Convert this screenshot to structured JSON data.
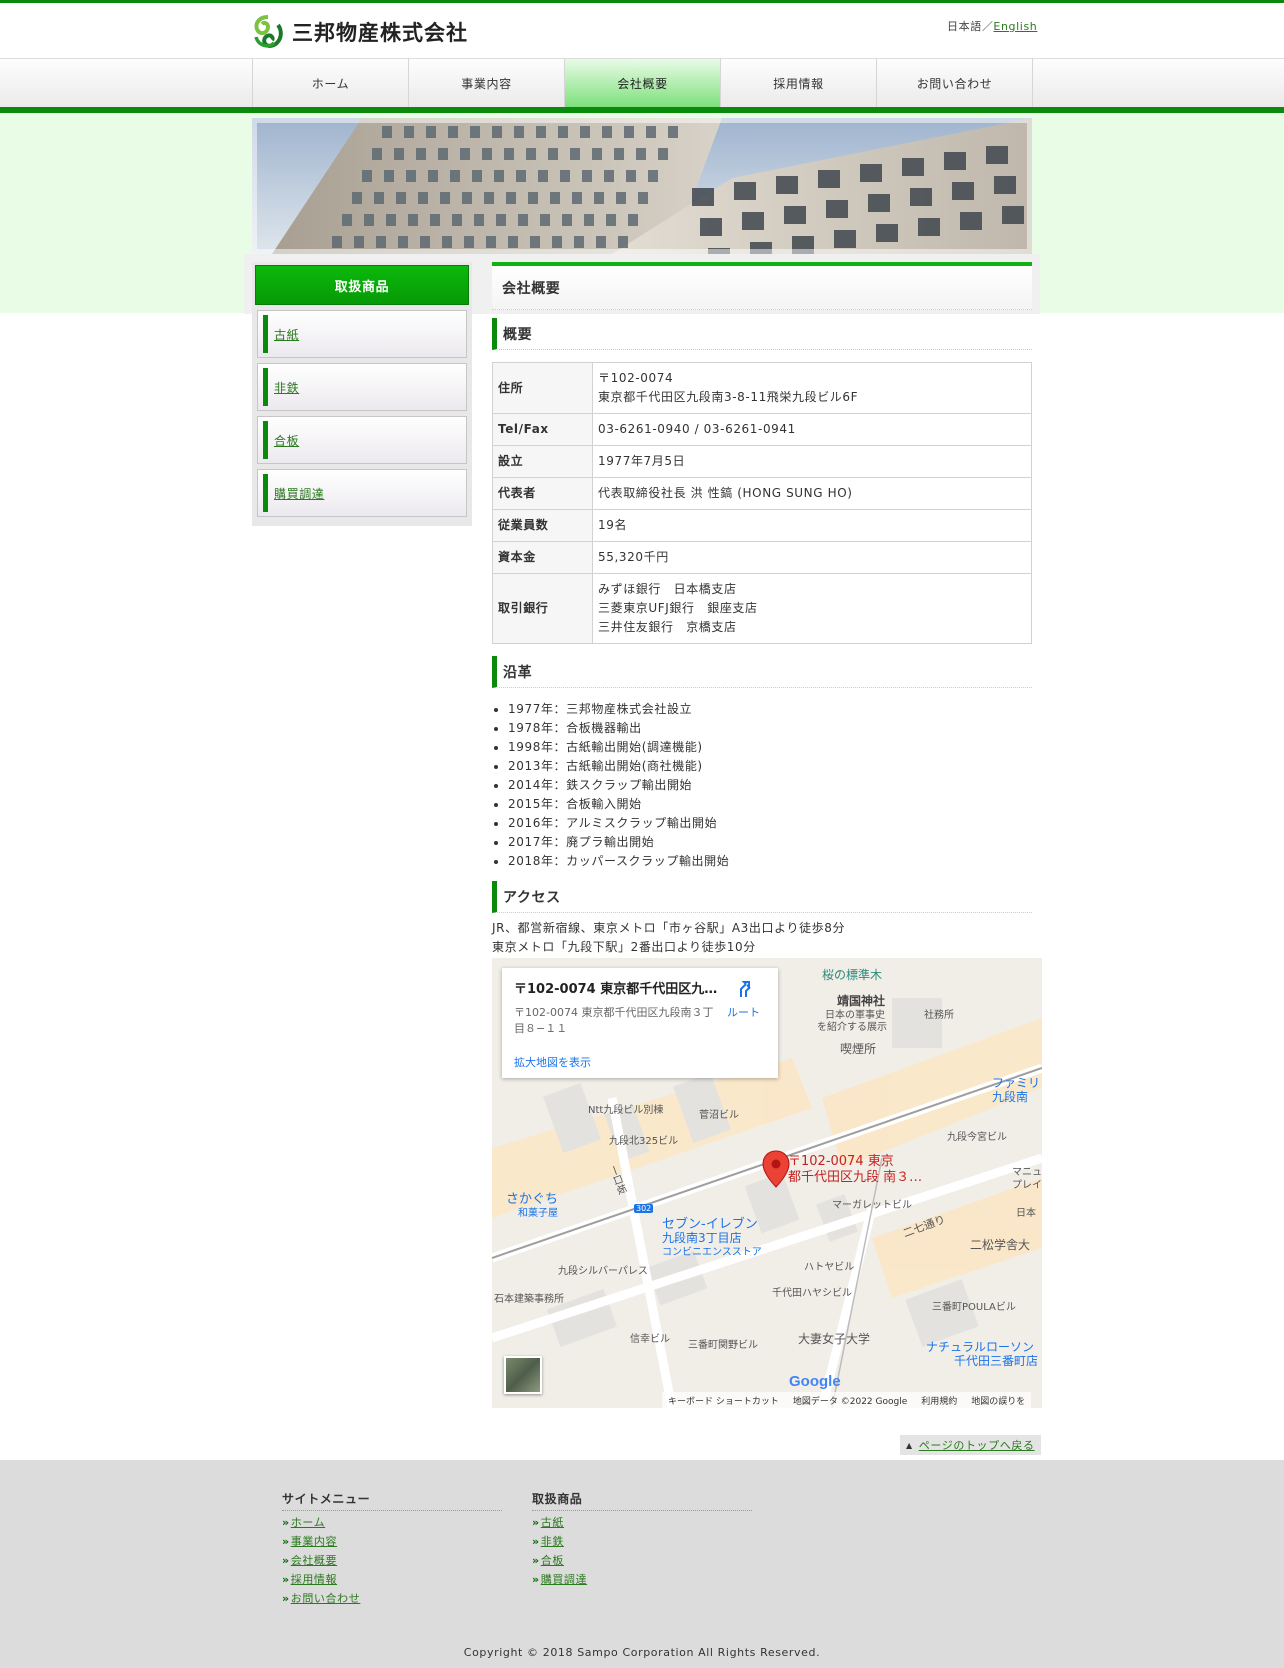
{
  "header": {
    "company_name": "三邦物産株式会社",
    "lang_current": "日本語",
    "lang_sep": "／",
    "lang_english": "English"
  },
  "nav": {
    "items": [
      "ホーム",
      "事業内容",
      "会社概要",
      "採用情報",
      "お問い合わせ"
    ],
    "active": "会社概要"
  },
  "sidebar": {
    "heading": "取扱商品",
    "items": [
      "古紙",
      "非鉄",
      "合板",
      "購買調達"
    ]
  },
  "main": {
    "page_title": "会社概要",
    "overview_heading": "概要",
    "overview_rows": [
      {
        "key": "住所",
        "lines": [
          "〒102-0074",
          "東京都千代田区九段南3-8-11飛栄九段ビル6F"
        ]
      },
      {
        "key": "Tel/Fax",
        "lines": [
          "03-6261-0940 / 03-6261-0941"
        ]
      },
      {
        "key": "設立",
        "lines": [
          "1977年7月5日"
        ]
      },
      {
        "key": "代表者",
        "lines": [
          "代表取締役社長 洪 性鎬 (HONG SUNG HO)"
        ]
      },
      {
        "key": "従業員数",
        "lines": [
          "19名"
        ]
      },
      {
        "key": "資本金",
        "lines": [
          "55,320千円"
        ]
      },
      {
        "key": "取引銀行",
        "lines": [
          "みずほ銀行　日本橋支店",
          "三菱東京UFJ銀行　銀座支店",
          "三井住友銀行　京橋支店"
        ]
      }
    ],
    "history_heading": "沿革",
    "history": [
      "1977年：三邦物産株式会社設立",
      "1978年：合板機器輸出",
      "1998年：古紙輸出開始(調達機能)",
      "2013年：古紙輸出開始(商社機能)",
      "2014年：鉄スクラップ輸出開始",
      "2015年：合板輸入開始",
      "2016年：アルミスクラップ輸出開始",
      "2017年：廃プラ輸出開始",
      "2018年：カッパースクラップ輸出開始"
    ],
    "access_heading": "アクセス",
    "access_lines": [
      "JR、都営新宿線、東京メトロ「市ヶ谷駅」A3出口より徒歩8分",
      "東京メトロ「九段下駅」2番出口より徒歩10分"
    ]
  },
  "map": {
    "card_title": "〒102-0074 東京都千代田区九…",
    "card_address": "〒102-0074 東京都千代田区九段南３丁目８−１１",
    "card_link": "拡大地図を表示",
    "route_label": "ルート",
    "pin_label_line1": "〒102-0074 東京",
    "pin_label_line2": "都千代田区九段 南３…",
    "labels": [
      "桜の標準木",
      "靖国神社",
      "日本の軍事史",
      "を紹介する展示",
      "社務所",
      "喫煙所",
      "Ntt九段ビル別棟",
      "菅沼ビル",
      "九段北325ビル",
      "九段今宮ビル",
      "さかぐち",
      "和菓子屋",
      "セブン-イレブン",
      "九段南3丁目店",
      "コンビニエンスストア",
      "マーガレットビル",
      "二七通り",
      "二松学舎大",
      "ハトヤビル",
      "九段シルバーパレス",
      "石本建築事務所",
      "千代田ハヤシビル",
      "三番町POULAビル",
      "大妻女子大学",
      "信幸ビル",
      "三番町関野ビル",
      "ナチュラルローソン",
      "千代田三番町店",
      "ファミリ",
      "九段南",
      "一口坂",
      "302",
      "マニュラ",
      "プレイス",
      "日本"
    ],
    "footer_items": [
      "キーボード ショートカット",
      "地図データ ©2022 Google",
      "利用規約",
      "地図の誤りを"
    ],
    "google_logo": "Google"
  },
  "page_top": "ページのトップへ戻る",
  "footer": {
    "col1_heading": "サイトメニュー",
    "col1_items": [
      "ホーム",
      "事業内容",
      "会社概要",
      "採用情報",
      "お問い合わせ"
    ],
    "col2_heading": "取扱商品",
    "col2_items": [
      "古紙",
      "非鉄",
      "合板",
      "購買調達"
    ],
    "copyright": "Copyright © 2018 Sampo Corporation All Rights Reserved."
  },
  "colors": {
    "brand_green": "#0a8a0a",
    "nav_active": "#7be07a",
    "link": "#2a7a1e"
  }
}
